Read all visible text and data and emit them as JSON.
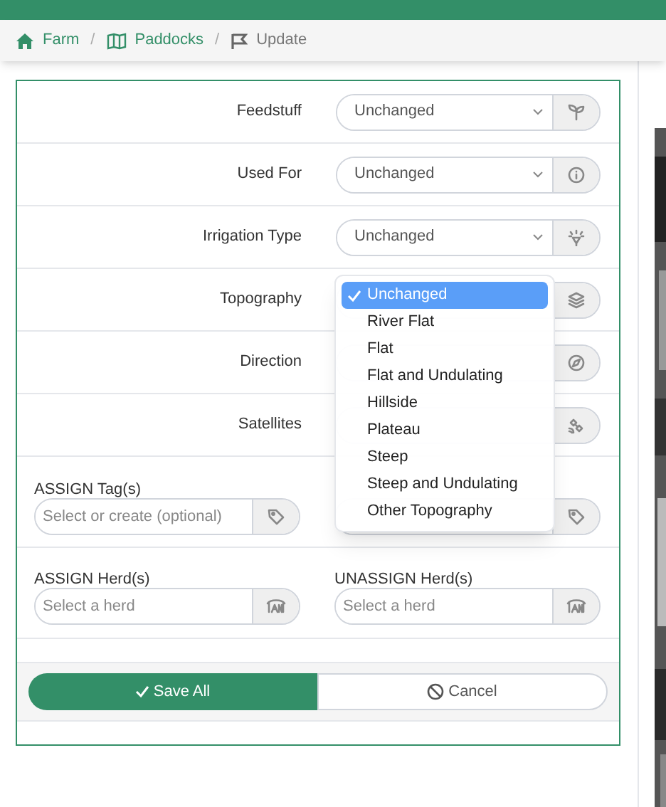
{
  "breadcrumb": [
    {
      "label": "Farm",
      "current": false
    },
    {
      "separator": "/",
      "label": "Paddocks",
      "current": false
    },
    {
      "separator": "/",
      "label": "Update",
      "current": true
    }
  ],
  "fields": [
    {
      "label": "Feedstuff",
      "value": "Unchanged"
    },
    {
      "label": "Used For",
      "value": "Unchanged"
    },
    {
      "label": "Irrigation Type",
      "value": "Unchanged"
    },
    {
      "label": "Topography"
    },
    {
      "label": "Direction"
    },
    {
      "label": "Satellites"
    }
  ],
  "tags": {
    "assign": {
      "label": "ASSIGN Tag(s)",
      "placeholder": "Select or create (optional)"
    }
  },
  "herds": [
    {
      "label": "ASSIGN Herd(s)",
      "placeholder": "Select a herd"
    },
    {
      "label": "UNASSIGN Herd(s)",
      "placeholder": "Select a herd"
    }
  ],
  "dropdown": {
    "options": [
      {
        "label": "Unchanged",
        "selected": true
      },
      {
        "label": "River Flat",
        "selected": false
      },
      {
        "label": "Flat",
        "selected": false
      },
      {
        "label": "Flat and Undulating",
        "selected": false
      },
      {
        "label": "Hillside",
        "selected": false
      },
      {
        "label": "Plateau",
        "selected": false
      },
      {
        "label": "Steep",
        "selected": false
      },
      {
        "label": "Steep and Undulating",
        "selected": false
      },
      {
        "label": "Other Topography",
        "selected": false
      }
    ]
  },
  "buttons": [
    {
      "label": "Save All",
      "kind": "primary"
    },
    {
      "label": "Cancel",
      "kind": "secondary"
    }
  ]
}
